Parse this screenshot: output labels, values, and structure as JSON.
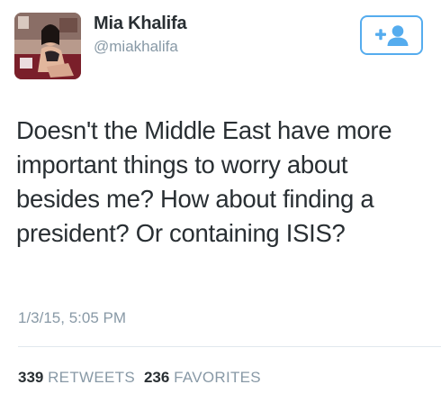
{
  "user": {
    "display_name": "Mia Khalifa",
    "handle": "@miakhalifa",
    "avatar_icon": "profile-photo"
  },
  "follow_button": {
    "icon": "follow-user-icon",
    "color": "#55acee"
  },
  "tweet": {
    "text": "Doesn't the Middle East have more important things to worry about besides me? How about finding a president? Or containing ISIS?",
    "timestamp": "1/3/15, 5:05 PM"
  },
  "stats": {
    "retweets_count": "339",
    "retweets_label": "RETWEETS",
    "favorites_count": "236",
    "favorites_label": "FAVORITES"
  },
  "colors": {
    "text": "#292f33",
    "muted": "#8899a6",
    "accent": "#55acee",
    "divider": "#e1e8ed"
  }
}
